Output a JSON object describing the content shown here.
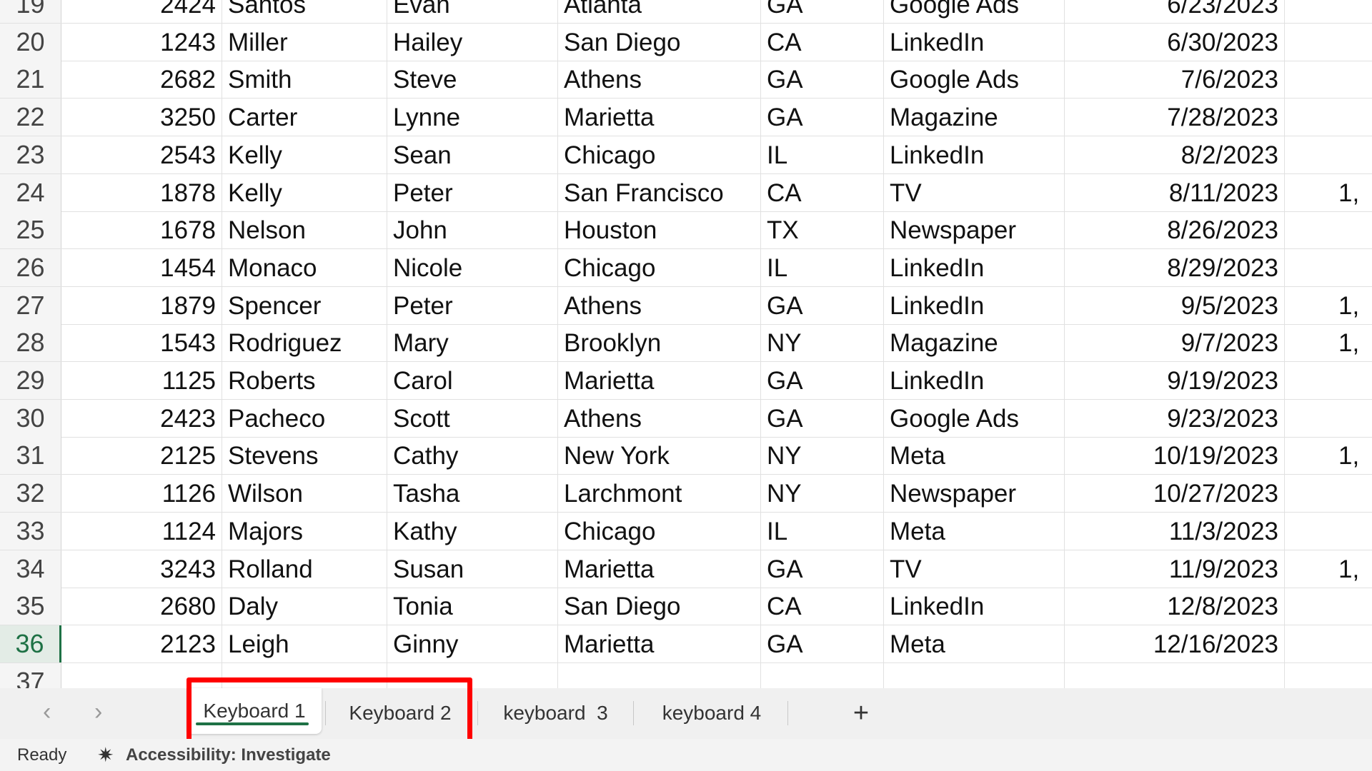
{
  "grid": {
    "active_row": "36",
    "rows": [
      [
        "19",
        "2424",
        "Santos",
        "Evan",
        "Atlanta",
        "GA",
        "Google Ads",
        "6/23/2023",
        ""
      ],
      [
        "20",
        "1243",
        "Miller",
        "Hailey",
        "San Diego",
        "CA",
        "LinkedIn",
        "6/30/2023",
        ""
      ],
      [
        "21",
        "2682",
        "Smith",
        "Steve",
        "Athens",
        "GA",
        "Google Ads",
        "7/6/2023",
        ""
      ],
      [
        "22",
        "3250",
        "Carter",
        "Lynne",
        "Marietta",
        "GA",
        "Magazine",
        "7/28/2023",
        ""
      ],
      [
        "23",
        "2543",
        "Kelly",
        "Sean",
        "Chicago",
        "IL",
        "LinkedIn",
        "8/2/2023",
        ""
      ],
      [
        "24",
        "1878",
        "Kelly",
        "Peter",
        "San Francisco",
        "CA",
        "TV",
        "8/11/2023",
        "1,"
      ],
      [
        "25",
        "1678",
        "Nelson",
        "John",
        "Houston",
        "TX",
        "Newspaper",
        "8/26/2023",
        ""
      ],
      [
        "26",
        "1454",
        "Monaco",
        "Nicole",
        "Chicago",
        "IL",
        "LinkedIn",
        "8/29/2023",
        ""
      ],
      [
        "27",
        "1879",
        "Spencer",
        "Peter",
        "Athens",
        "GA",
        "LinkedIn",
        "9/5/2023",
        "1,"
      ],
      [
        "28",
        "1543",
        "Rodriguez",
        "Mary",
        "Brooklyn",
        "NY",
        "Magazine",
        "9/7/2023",
        "1,"
      ],
      [
        "29",
        "1125",
        "Roberts",
        "Carol",
        "Marietta",
        "GA",
        "LinkedIn",
        "9/19/2023",
        ""
      ],
      [
        "30",
        "2423",
        "Pacheco",
        "Scott",
        "Athens",
        "GA",
        "Google Ads",
        "9/23/2023",
        ""
      ],
      [
        "31",
        "2125",
        "Stevens",
        "Cathy",
        "New York",
        "NY",
        "Meta",
        "10/19/2023",
        "1,"
      ],
      [
        "32",
        "1126",
        "Wilson",
        "Tasha",
        "Larchmont",
        "NY",
        "Newspaper",
        "10/27/2023",
        ""
      ],
      [
        "33",
        "1124",
        "Majors",
        "Kathy",
        "Chicago",
        "IL",
        "Meta",
        "11/3/2023",
        ""
      ],
      [
        "34",
        "3243",
        "Rolland",
        "Susan",
        "Marietta",
        "GA",
        "TV",
        "11/9/2023",
        "1,"
      ],
      [
        "35",
        "2680",
        "Daly",
        "Tonia",
        "San Diego",
        "CA",
        "LinkedIn",
        "12/8/2023",
        ""
      ],
      [
        "36",
        "2123",
        "Leigh",
        "Ginny",
        "Marietta",
        "GA",
        "Meta",
        "12/16/2023",
        ""
      ],
      [
        "37",
        "",
        "",
        "",
        "",
        "",
        "",
        "",
        ""
      ]
    ]
  },
  "sheet_tabs": {
    "prev_icon": "chevron-left-icon",
    "next_icon": "chevron-right-icon",
    "tabs": [
      {
        "label": "Keyboard 1",
        "active": true
      },
      {
        "label": "Keyboard 2",
        "active": false
      },
      {
        "label": "keyboard  3",
        "active": false
      },
      {
        "label": "keyboard 4",
        "active": false
      }
    ],
    "add_label": "+"
  },
  "highlight_color": "#ff0000",
  "accent_color": "#1e7145",
  "status": {
    "ready": "Ready",
    "accessibility": "Accessibility: Investigate"
  }
}
